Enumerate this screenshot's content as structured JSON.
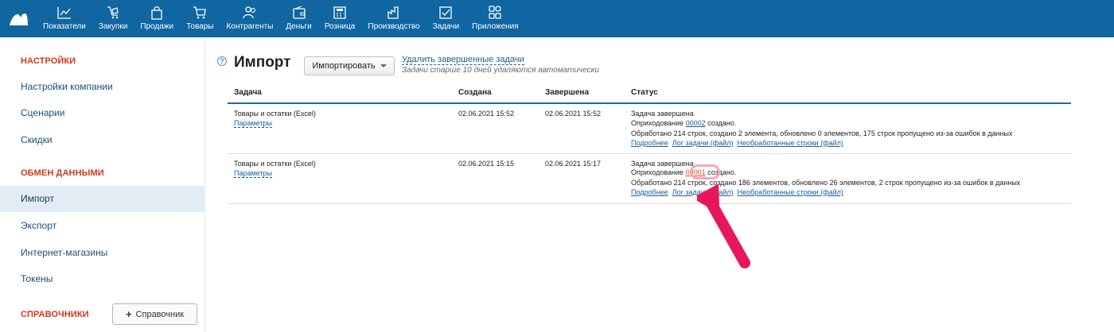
{
  "nav": {
    "items": [
      {
        "label": "Показатели",
        "icon": "chart-icon"
      },
      {
        "label": "Закупки",
        "icon": "purchases-icon"
      },
      {
        "label": "Продажи",
        "icon": "bag-icon"
      },
      {
        "label": "Товары",
        "icon": "cart-icon"
      },
      {
        "label": "Контрагенты",
        "icon": "people-icon"
      },
      {
        "label": "Деньги",
        "icon": "wallet-icon"
      },
      {
        "label": "Розница",
        "icon": "cash-register-icon"
      },
      {
        "label": "Производство",
        "icon": "factory-icon"
      },
      {
        "label": "Задачи",
        "icon": "checkbox-icon"
      },
      {
        "label": "Приложения",
        "icon": "apps-icon"
      }
    ]
  },
  "sidebar": {
    "settings_header": "НАСТРОЙКИ",
    "company_settings": "Настройки компании",
    "scenarios": "Сценарии",
    "discounts": "Скидки",
    "exchange_header": "ОБМЕН ДАННЫМИ",
    "import": "Импорт",
    "export": "Экспорт",
    "online_stores": "Интернет-магазины",
    "tokens": "Токены",
    "directories_header": "СПРАВОЧНИКИ",
    "directory_button": "Справочник"
  },
  "main": {
    "help_symbol": "?",
    "title": "Импорт",
    "import_button": "Импортировать",
    "delete_link": "Удалить завершенные задачи",
    "delete_note": "Задачи старше 10 дней удаляются автоматически",
    "columns": {
      "task": "Задача",
      "created": "Создана",
      "finished": "Завершена",
      "status": "Статус"
    },
    "rows": [
      {
        "task": "Товары и остатки (Excel)",
        "params": "Параметры",
        "created": "02.06.2021 15:52",
        "finished": "02.06.2021 15:52",
        "status_title": "Задача завершена",
        "posting_prefix": "Оприходование ",
        "posting_number": "00002",
        "posting_suffix": " создано.",
        "summary": "Обработано 214 строк, создано 2 элемента, обновлено 0 элементов, 175 строк пропущено из-за ошибок в данных",
        "link_details": "Подробнее",
        "link_log": "Лог задачи (файл)",
        "link_unprocessed": "Необработанные строки (файл)"
      },
      {
        "task": "Товары и остатки (Excel)",
        "params": "Параметры",
        "created": "02.06.2021 15:15",
        "finished": "02.06.2021 15:17",
        "status_title": "Задача завершена",
        "posting_prefix": "Оприходование ",
        "posting_number": "00001",
        "posting_suffix": " создано.",
        "summary": "Обработано 214 строк, создано 186 элементов, обновлено 26 элементов, 2 строк пропущено из-за ошибок в данных",
        "link_details": "Подробнее",
        "link_log": "Лог задачи (файл)",
        "link_unprocessed": "Необработанные строки (файл)"
      }
    ]
  },
  "colors": {
    "topbar": "#0f66a0",
    "header_accent": "#d2361b",
    "link": "#1a5d99",
    "highlight": "#d9561a",
    "arrow": "#e8175d"
  }
}
